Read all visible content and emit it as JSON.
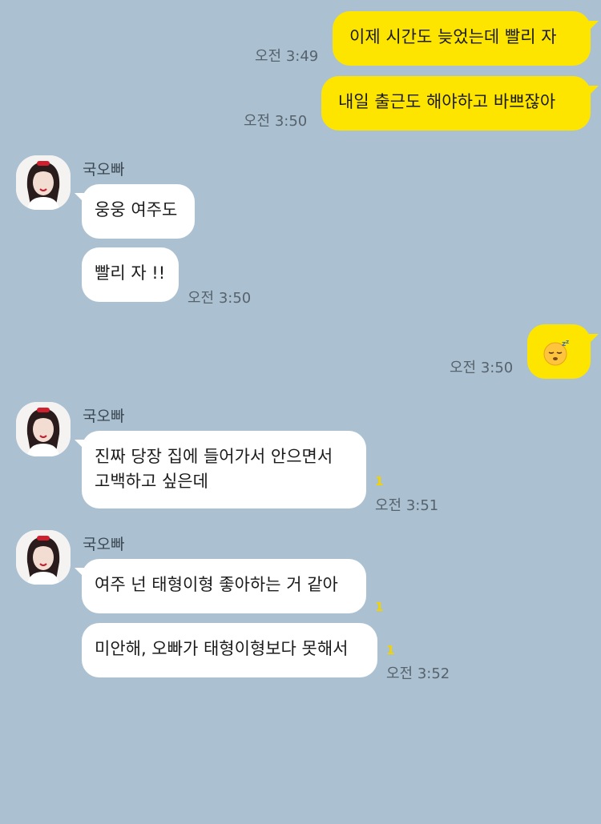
{
  "messages": [
    {
      "text": "이제 시간도 늦었는데 빨리 자",
      "time": "오전 3:49"
    },
    {
      "text": "내일 출근도 해야하고 바쁘잖아",
      "time": "오전 3:50"
    },
    {
      "sender": "국오빠",
      "text": "웅웅 여주도"
    },
    {
      "text": "빨리 자 !!",
      "time": "오전 3:50"
    },
    {
      "emoji": "sleeping-face",
      "time": "오전 3:50"
    },
    {
      "sender": "국오빠",
      "text_line1": "진짜 당장 집에 들어가서 안으면서",
      "text_line2": "고백하고 싶은데",
      "unread": "1",
      "time": "오전 3:51"
    },
    {
      "sender": "국오빠",
      "text": "여주 넌 태형이형 좋아하는 거 같아",
      "unread": "1"
    },
    {
      "text": "미안해, 오빠가 태형이형보다 못해서",
      "unread": "1",
      "time": "오전 3:52"
    }
  ],
  "colors": {
    "background": "#abc1d1",
    "my_bubble": "#fee500",
    "their_bubble": "#ffffff",
    "unread": "#f1d300"
  }
}
